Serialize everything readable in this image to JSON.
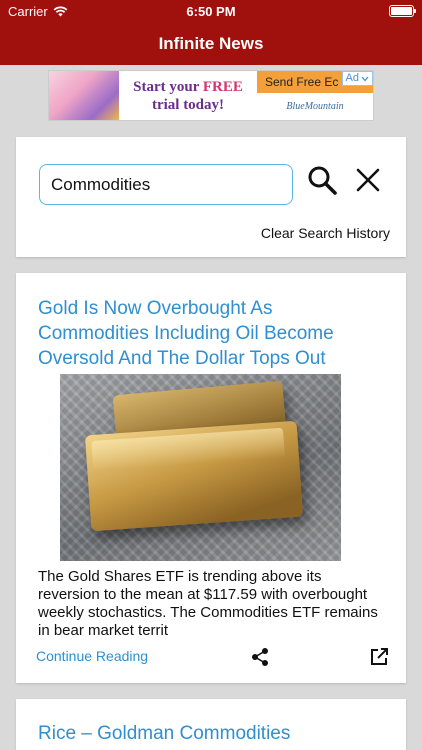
{
  "status_bar": {
    "carrier": "Carrier",
    "time": "6:50 PM"
  },
  "app": {
    "title": "Infinite News"
  },
  "ad": {
    "promo_prefix": "Start your ",
    "promo_highlight": "FREE",
    "promo_suffix": "trial today!",
    "cta": "Send Free Ec",
    "brand": "BlueMountain",
    "chip": "Ad"
  },
  "search": {
    "value": "Commodities",
    "clear_history_label": "Clear Search History"
  },
  "articles": [
    {
      "headline": "Gold Is Now Overbought As Commodities Including Oil Become Oversold And The Dollar Tops Out",
      "summary": "The Gold Shares ETF is trending above its reversion to the mean at $117.59 with overbought weekly stochastics. The Commodities ETF remains in bear market territ",
      "continue_label": "Continue Reading"
    },
    {
      "headline": "Rice – Goldman Commodities"
    }
  ],
  "colors": {
    "header_red": "#a0100c",
    "link_blue": "#2f8fd0",
    "background": "#d9d9d9"
  },
  "icons": [
    "wifi-icon",
    "battery-icon",
    "search-icon",
    "close-icon",
    "share-icon",
    "open-external-icon",
    "chevron-down-icon"
  ]
}
